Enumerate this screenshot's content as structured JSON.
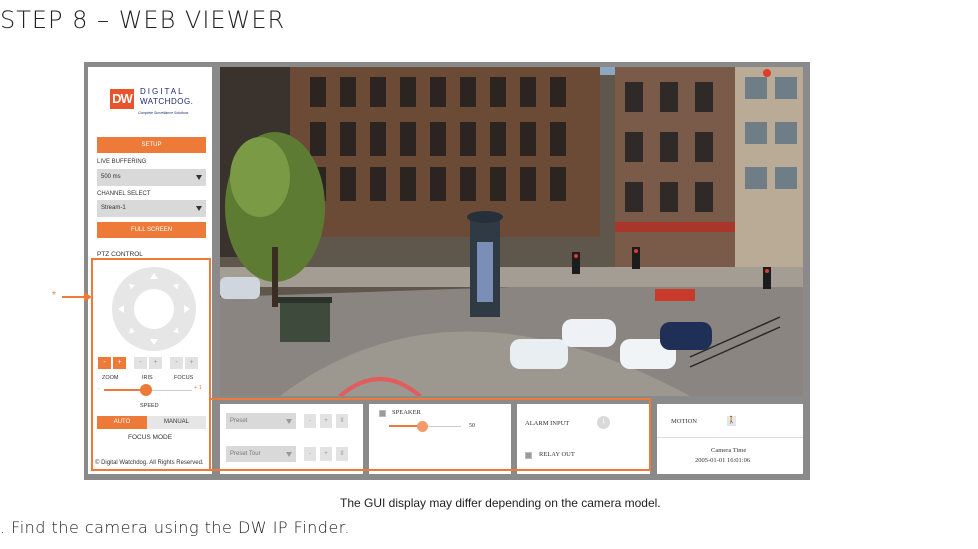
{
  "document": {
    "heading": "STEP 8 – WEB VIEWER",
    "caption": "The GUI display may differ depending on the camera model.",
    "step_text": ".  Find the camera using the DW IP Finder.",
    "annotation_mark": "*"
  },
  "logo": {
    "mark": "DW",
    "line1": "DIGITAL",
    "line2": "WATCHDOG.",
    "tagline": "Complete Surveillance Solutions"
  },
  "sidebar": {
    "setup_label": "SETUP",
    "live_buffering_label": "LIVE BUFFERING",
    "live_buffering_value": "500 ms",
    "channel_select_label": "CHANNEL SELECT",
    "channel_select_value": "Stream-1",
    "full_screen_label": "FULL SCREEN",
    "copyright": "© Digital Watchdog. All Rights Reserved."
  },
  "ptz": {
    "title": "PTZ CONTROL",
    "minus": "-",
    "plus": "+",
    "zoom_label": "ZOOM",
    "iris_label": "IRIS",
    "focus_label": "FOCUS",
    "speed_min": "-",
    "speed_max": "+ 1",
    "speed_label": "SPEED",
    "speed_level": 0.45,
    "focus_auto": "AUTO",
    "focus_manual": "MANUAL",
    "focus_mode_label": "FOCUS MODE"
  },
  "bottom": {
    "preset_value": "Preset",
    "preset_tour_value": "Preset Tour",
    "btn_a": "-",
    "btn_b": "+",
    "btn_c": "II",
    "speaker_label": "SPEAKER",
    "speaker_value": "50",
    "speaker_level": 0.5,
    "alarm_input_label": "ALARM INPUT",
    "alarm_input_indicator": "1",
    "relay_out_label": "RELAY OUT",
    "motion_label": "MOTION",
    "camera_time_label": "Camera Time",
    "camera_time_value": "2005-01-01 16:01:06"
  },
  "colors": {
    "accent": "#ee7a3a",
    "frame": "#8a8a8a",
    "panel": "#ffffff",
    "control_gray": "#d9d9d9"
  },
  "icons": {
    "motion": "motion-walker-icon",
    "joystick": "ptz-joystick-icon"
  }
}
